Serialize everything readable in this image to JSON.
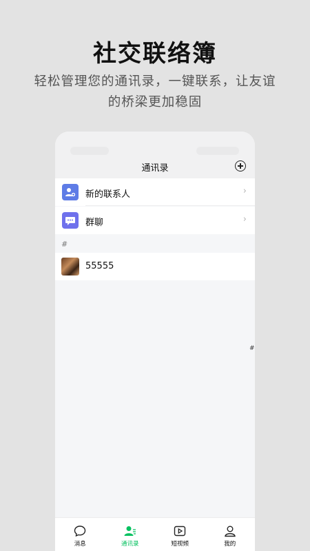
{
  "promo": {
    "title": "社交联络簿",
    "subtitle_line1": "轻松管理您的通讯录，一键联系，让友谊",
    "subtitle_line2": "的桥梁更加稳固"
  },
  "navbar": {
    "title": "通讯录",
    "add_icon": "plus-circle-icon"
  },
  "menu": [
    {
      "label": "新的联系人",
      "icon": "new-contact-icon",
      "icon_color": "#5e7ce6"
    },
    {
      "label": "群聊",
      "icon": "group-chat-icon",
      "icon_color": "#6f71ec"
    }
  ],
  "section": {
    "header": "#"
  },
  "contacts": [
    {
      "name": "55555"
    }
  ],
  "index_bar": {
    "item": "#"
  },
  "tabs": [
    {
      "label": "消息",
      "icon": "chat-bubble-icon",
      "active": false
    },
    {
      "label": "通讯录",
      "icon": "contacts-icon",
      "active": true
    },
    {
      "label": "短视频",
      "icon": "video-play-icon",
      "active": false
    },
    {
      "label": "我的",
      "icon": "person-icon",
      "active": false
    }
  ],
  "colors": {
    "accent": "#07c160",
    "background": "#e3e3e3"
  }
}
